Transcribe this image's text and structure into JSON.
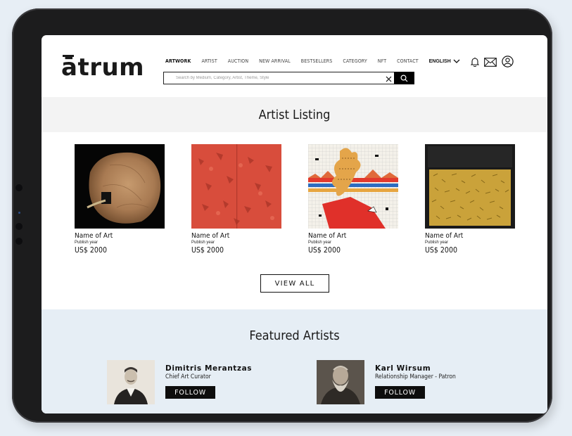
{
  "brand": {
    "logo": "ātrum"
  },
  "nav": {
    "items": [
      "ARTWORK",
      "ARTIST",
      "AUCTION",
      "NEW ARRIVAL",
      "BESTSELLERS",
      "CATEGORY",
      "NFT",
      "CONTACT"
    ],
    "active": "ARTWORK",
    "language": "ENGLISH"
  },
  "header_icons": [
    "bell-icon",
    "mail-icon",
    "user-icon"
  ],
  "search": {
    "placeholder": "Search by Medium, Category, Artist, Theme, Style",
    "value": ""
  },
  "artist_listing": {
    "title": "Artist Listing",
    "cards": [
      {
        "name": "Name of Art",
        "year": "Publish year",
        "price": "US$ 2000"
      },
      {
        "name": "Name of Art",
        "year": "Publish year",
        "price": "US$ 2000"
      },
      {
        "name": "Name of Art",
        "year": "Publish year",
        "price": "US$ 2000"
      },
      {
        "name": "Name of Art",
        "year": "Publish year",
        "price": "US$ 2000"
      }
    ],
    "view_all_label": "VIEW ALL"
  },
  "featured": {
    "title": "Featured Artists",
    "artists": [
      {
        "name": "Dimitris Merantzas",
        "role": "Chief Art Curator",
        "follow_label": "FOLLOW"
      },
      {
        "name": "Karl Wirsum",
        "role": "Relationship Manager - Patron",
        "follow_label": "FOLLOW"
      }
    ]
  },
  "colors": {
    "accent": "#000000",
    "banner_bg": "#f3f3f3",
    "featured_bg": "#e6eef5",
    "page_bg": "#e7eef5"
  }
}
